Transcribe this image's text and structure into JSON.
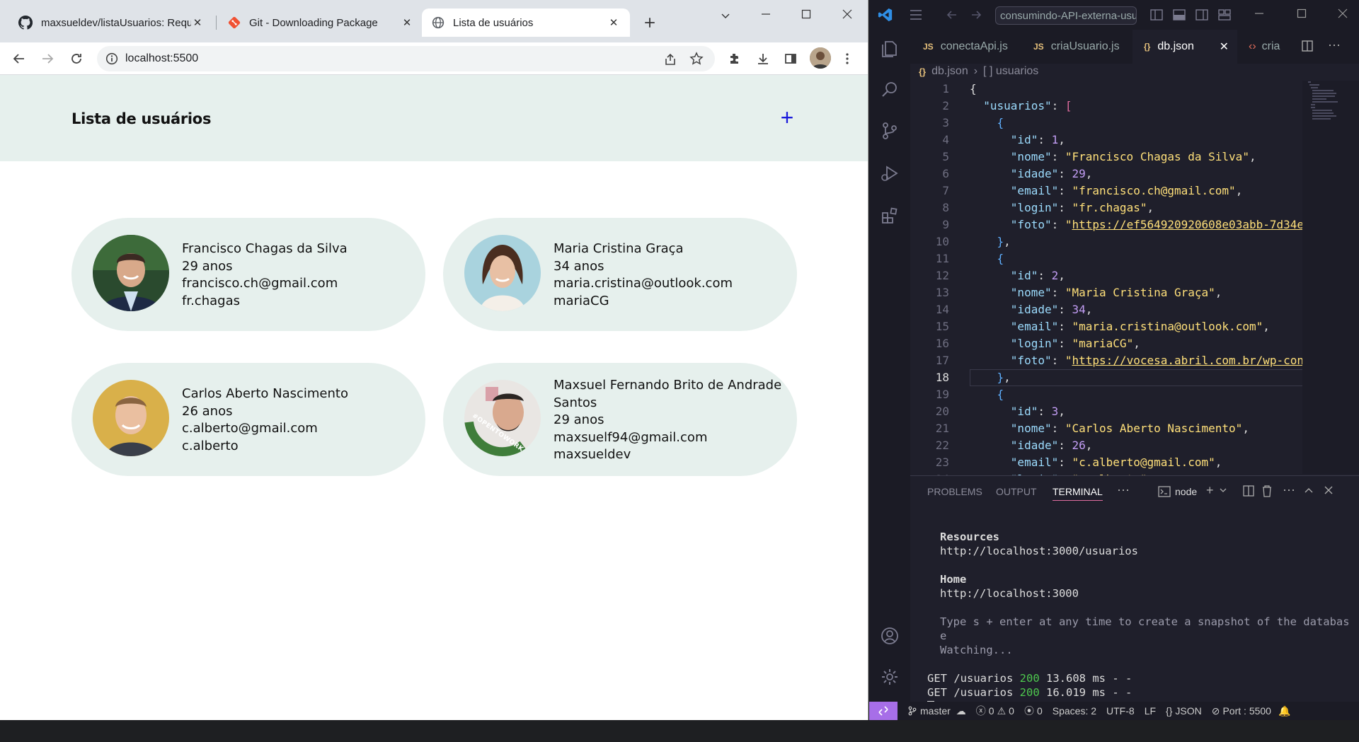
{
  "browser": {
    "tabs": [
      {
        "title": "maxsueldev/listaUsuarios: Requ",
        "icon": "github-icon"
      },
      {
        "title": "Git - Downloading Package",
        "icon": "git-icon"
      },
      {
        "title": "Lista de usuários",
        "icon": "globe-icon",
        "active": true
      }
    ],
    "address": "localhost:5500"
  },
  "page": {
    "title": "Lista de usuários",
    "add_label": "+",
    "users": [
      {
        "nome": "Francisco Chagas da Silva",
        "idade": "29 anos",
        "email": "francisco.ch@gmail.com",
        "login": "fr.chagas"
      },
      {
        "nome": "Maria Cristina Graça",
        "idade": "34 anos",
        "email": "maria.cristina@outlook.com",
        "login": "mariaCG"
      },
      {
        "nome": "Carlos Aberto Nascimento",
        "idade": "26 anos",
        "email": "c.alberto@gmail.com",
        "login": "c.alberto"
      },
      {
        "nome": "Maxsuel Fernando Brito de Andrade Santos",
        "idade": "29 anos",
        "email": "maxsuelf94@gmail.com",
        "login": "maxsueldev"
      }
    ],
    "badge_text": "#OPENTOWORK"
  },
  "vscode": {
    "search": "consumindo-API-externa-usua",
    "tabs": [
      "conectaApi.js",
      "criaUsuario.js",
      "db.json",
      "cria"
    ],
    "active_tab": "db.json",
    "breadcrumb": [
      "db.json",
      "[ ] usuarios"
    ],
    "panel_tabs": [
      "PROBLEMS",
      "OUTPUT",
      "TERMINAL"
    ],
    "terminal_shell": "node",
    "terminal": {
      "resources_label": "Resources",
      "resources_url": "http://localhost:3000/usuarios",
      "home_label": "Home",
      "home_url": "http://localhost:3000",
      "snapshot_hint": "Type s + enter at any time to create a snapshot of the database",
      "watching": "Watching...",
      "requests": [
        {
          "method": "GET /usuarios",
          "status": "200",
          "time": "13.608 ms - -"
        },
        {
          "method": "GET /usuarios",
          "status": "200",
          "time": "16.019 ms - -"
        }
      ]
    },
    "status": {
      "branch": "master",
      "errors": "0",
      "warnings": "0",
      "ports": "0",
      "spaces": "Spaces: 2",
      "encoding": "UTF-8",
      "eol": "LF",
      "language": "JSON",
      "port": "Port : 5500"
    }
  }
}
